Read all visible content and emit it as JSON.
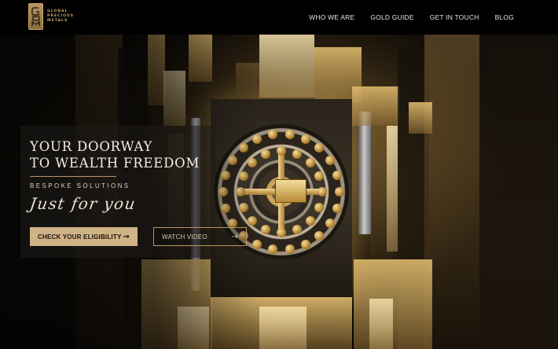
{
  "brand": {
    "logo_line1": "GLOBAL",
    "logo_line2": "PRECIOUS",
    "logo_line3": "METALS",
    "logo_icon": "gpm-monogram-icon",
    "accent_color": "#c6a46a"
  },
  "nav": {
    "items": [
      {
        "label": "WHO WE ARE"
      },
      {
        "label": "GOLD GUIDE"
      },
      {
        "label": "GET IN TOUCH"
      },
      {
        "label": "BLOG"
      }
    ]
  },
  "hero": {
    "title_line1": "YOUR DOORWAY",
    "title_line2": "TO WEALTH FREEDOM",
    "subtitle": "BESPOKE SOLUTIONS",
    "script": "Just for you",
    "primary_cta": {
      "label": "CHECK YOUR ELIGIBILITY",
      "icon": "arrow-right-icon"
    },
    "secondary_cta": {
      "label": "WATCH VIDEO",
      "icon": "arrow-right-icon"
    }
  },
  "colors": {
    "header_bg": "#000000",
    "primary_button": "#cfb286",
    "gold": "#b89560"
  }
}
